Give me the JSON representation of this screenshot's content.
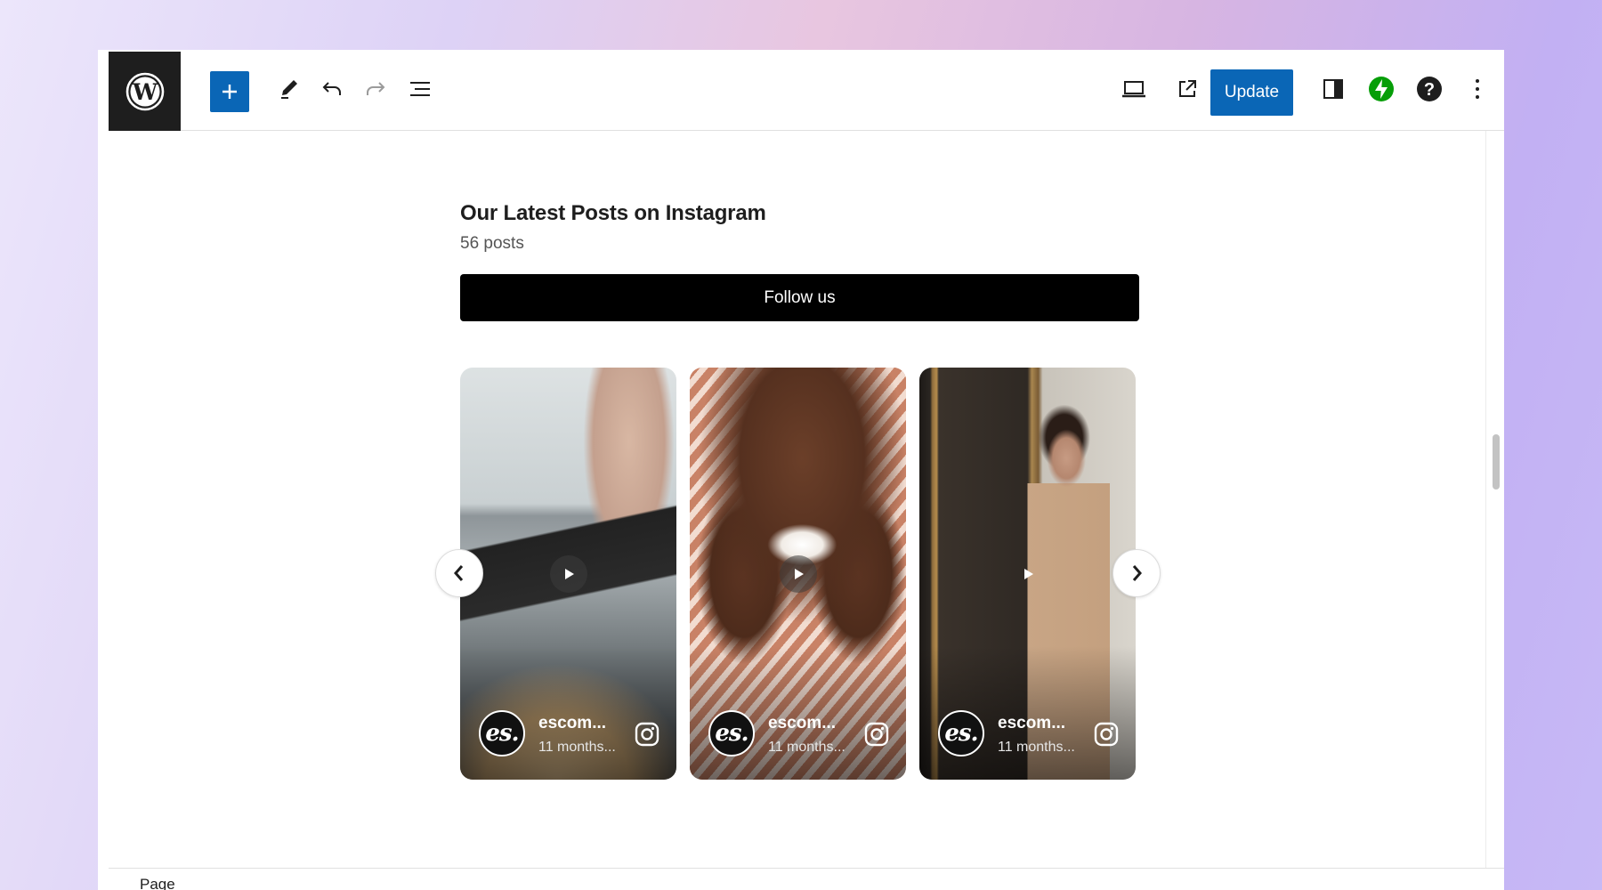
{
  "toolbar": {
    "logo_icon": "wordpress-logo-icon",
    "add_icon": "plus-icon",
    "tools_icon": "pencil-icon",
    "undo_icon": "undo-icon",
    "redo_icon": "redo-icon",
    "list_view_icon": "list-view-icon",
    "preview_icon": "laptop-icon",
    "view_page_icon": "external-link-icon",
    "update_label": "Update",
    "settings_icon": "sidebar-toggle-icon",
    "jetpack_icon": "jetpack-bolt-icon",
    "help_icon": "help-icon",
    "options_icon": "more-vertical-icon",
    "accent_color": "#0a66b6",
    "jetpack_color": "#069e08"
  },
  "feed": {
    "title": "Our Latest Posts on Instagram",
    "post_count": "56 posts",
    "follow_label": "Follow us",
    "prev_icon": "chevron-left-icon",
    "next_icon": "chevron-right-icon",
    "cards": [
      {
        "avatar_text": "es.",
        "username": "escom...",
        "time": "11 months...",
        "media_icon": "play-icon",
        "platform_icon": "instagram-icon"
      },
      {
        "avatar_text": "es.",
        "username": "escom...",
        "time": "11 months...",
        "media_icon": "play-icon",
        "platform_icon": "instagram-icon"
      },
      {
        "avatar_text": "es.",
        "username": "escom...",
        "time": "11 months...",
        "media_icon": "play-icon",
        "platform_icon": "instagram-icon"
      }
    ]
  },
  "footer": {
    "breadcrumb": "Page"
  }
}
